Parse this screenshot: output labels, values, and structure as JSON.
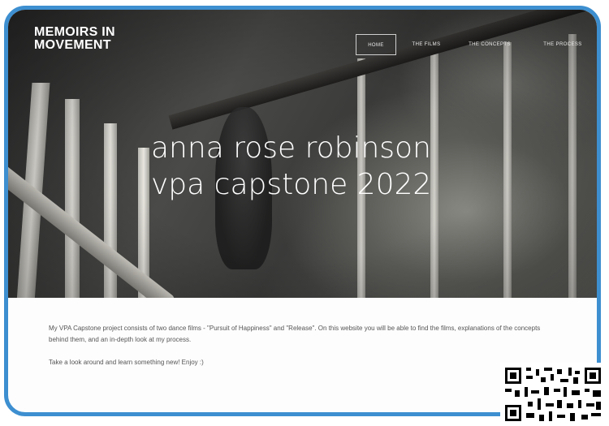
{
  "site": {
    "title": "MEMOIRS IN MOVEMENT"
  },
  "nav": {
    "items": [
      {
        "label": "HOME",
        "active": true
      },
      {
        "label": "THE FILMS",
        "active": false
      },
      {
        "label": "THE CONCEPTS",
        "active": false
      },
      {
        "label": "THE PROCESS",
        "active": false
      }
    ]
  },
  "hero": {
    "line1": "anna rose robinson",
    "line2": "vpa capstone 2022"
  },
  "content": {
    "paragraph1": "My VPA Capstone project consists of two dance films - \"Pursuit of Happiness\" and \"Release\". On this website you will be able to find the films, explanations of the concepts behind them, and an in-depth look at my process.",
    "paragraph2": "Take a look around and learn something new! Enjoy :)"
  },
  "colors": {
    "frame_border": "#3d8fd0",
    "hero_text": "#ffffff",
    "body_text": "#555555"
  },
  "icons": {
    "qr": "qr-code"
  }
}
